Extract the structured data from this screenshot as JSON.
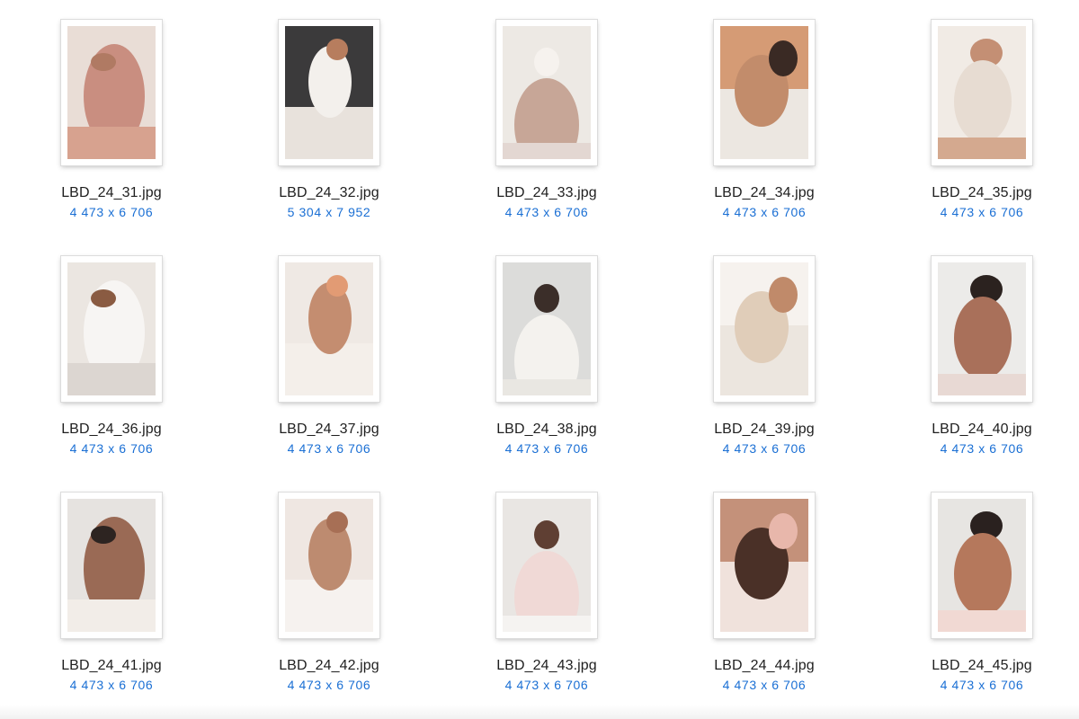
{
  "files": [
    {
      "name": "LBD_24_31.jpg",
      "dimensions": "4 473 x 6 706",
      "tones": [
        "#e9ddd6",
        "#c98e80",
        "#b07a63",
        "#d7a28f"
      ]
    },
    {
      "name": "LBD_24_32.jpg",
      "dimensions": "5 304 x 7 952",
      "tones": [
        "#3b3a3b",
        "#f3f0ec",
        "#b77d5e",
        "#e8e2dc"
      ]
    },
    {
      "name": "LBD_24_33.jpg",
      "dimensions": "4 473 x 6 706",
      "tones": [
        "#ede9e4",
        "#f6f2ee",
        "#c7a697",
        "#e3d7d2"
      ]
    },
    {
      "name": "LBD_24_34.jpg",
      "dimensions": "4 473 x 6 706",
      "tones": [
        "#ece7e1",
        "#c28c6b",
        "#3a2a24",
        "#d59b75"
      ]
    },
    {
      "name": "LBD_24_35.jpg",
      "dimensions": "4 473 x 6 706",
      "tones": [
        "#f1ebe5",
        "#e7dcd2",
        "#c48f74",
        "#d4a98f"
      ]
    },
    {
      "name": "LBD_24_36.jpg",
      "dimensions": "4 473 x 6 706",
      "tones": [
        "#ebe6e1",
        "#f7f5f3",
        "#8a5b42",
        "#dcd6d1"
      ]
    },
    {
      "name": "LBD_24_37.jpg",
      "dimensions": "4 473 x 6 706",
      "tones": [
        "#efe9e4",
        "#c48d70",
        "#e29b74",
        "#f4efea"
      ]
    },
    {
      "name": "LBD_24_38.jpg",
      "dimensions": "4 473 x 6 706",
      "tones": [
        "#dcdcda",
        "#3b2e29",
        "#f4f2ee",
        "#e9e7e2"
      ]
    },
    {
      "name": "LBD_24_39.jpg",
      "dimensions": "4 473 x 6 706",
      "tones": [
        "#ece6df",
        "#e0cdb9",
        "#c08a6a",
        "#f6f2ee"
      ]
    },
    {
      "name": "LBD_24_40.jpg",
      "dimensions": "4 473 x 6 706",
      "tones": [
        "#ecebe9",
        "#a9705a",
        "#2b221f",
        "#e8d9d4"
      ]
    },
    {
      "name": "LBD_24_41.jpg",
      "dimensions": "4 473 x 6 706",
      "tones": [
        "#e6e3e0",
        "#9a6a55",
        "#2d2421",
        "#f2ede8"
      ]
    },
    {
      "name": "LBD_24_42.jpg",
      "dimensions": "4 473 x 6 706",
      "tones": [
        "#efe7e2",
        "#bd8b70",
        "#a76f55",
        "#f6f2ef"
      ]
    },
    {
      "name": "LBD_24_43.jpg",
      "dimensions": "4 473 x 6 706",
      "tones": [
        "#e9e6e3",
        "#5f3f33",
        "#f0d9d6",
        "#f5f3f1"
      ]
    },
    {
      "name": "LBD_24_44.jpg",
      "dimensions": "4 473 x 6 706",
      "tones": [
        "#f0e2dc",
        "#4a3027",
        "#e8b7ab",
        "#c4917a"
      ]
    },
    {
      "name": "LBD_24_45.jpg",
      "dimensions": "4 473 x 6 706",
      "tones": [
        "#e7e5e2",
        "#b5785c",
        "#2a211f",
        "#f1d9d3"
      ]
    }
  ]
}
